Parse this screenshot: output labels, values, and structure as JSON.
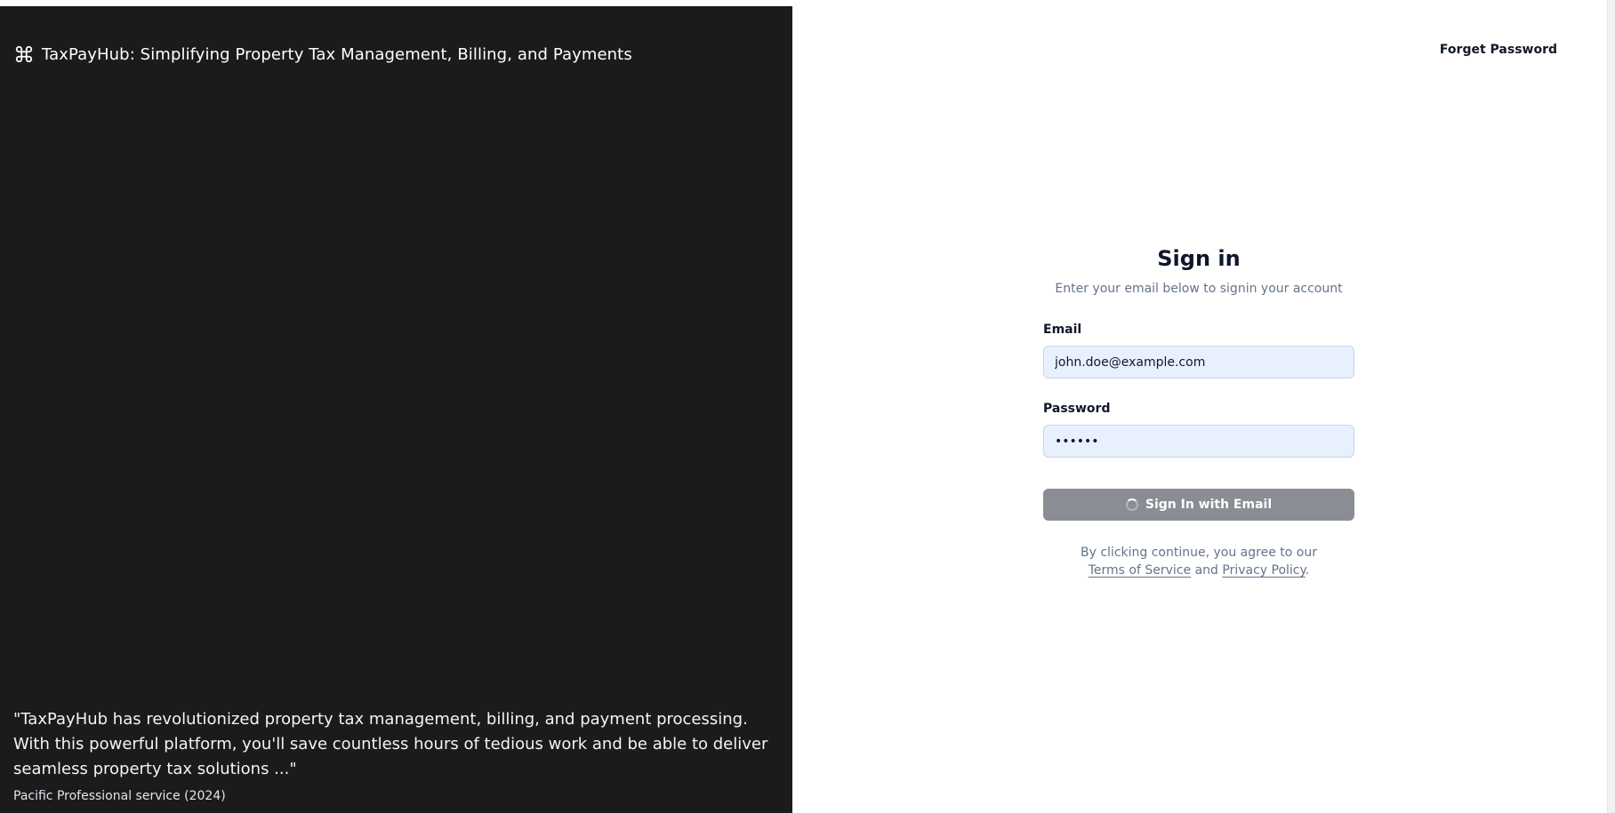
{
  "brand": {
    "icon": "command-icon",
    "title": "TaxPayHub: Simplifying Property Tax Management, Billing, and Payments"
  },
  "testimonial": {
    "quote": "\"TaxPayHub has revolutionized property tax management, billing, and payment processing. With this powerful platform, you'll save countless hours of tedious work and be able to deliver seamless property tax solutions ...\"",
    "author": "Pacific Professional service (2024)"
  },
  "header": {
    "forget_password": "Forget Password"
  },
  "form": {
    "title": "Sign in",
    "subtitle": "Enter your email below to signin your account",
    "email_label": "Email",
    "email_value": "john.doe@example.com",
    "password_label": "Password",
    "password_value": "••••••",
    "submit_label": "Sign In with Email",
    "submit_icon": "spinner-icon"
  },
  "terms": {
    "prefix": "By clicking continue, you agree to our ",
    "terms_link": "Terms of Service",
    "middle": " and ",
    "privacy_link": "Privacy Policy",
    "suffix": "."
  },
  "colors": {
    "left_panel_bg": "#1b1b1d",
    "input_bg": "#e8f0fe",
    "button_bg": "#8a8d93",
    "muted_text": "#64748b"
  }
}
